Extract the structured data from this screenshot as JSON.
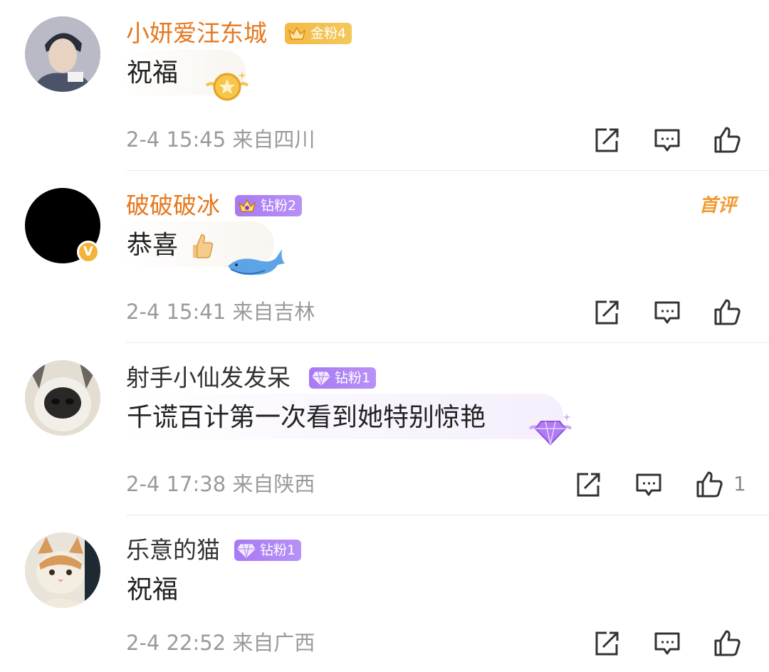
{
  "comments": [
    {
      "username": "小妍爱汪东城",
      "badge": "金粉4",
      "content": "祝福",
      "time": "2-4 15:45",
      "location": "来自四川",
      "first_tag": "",
      "likes": ""
    },
    {
      "username": "破破破冰",
      "badge": "钻粉2",
      "content": "恭喜",
      "time": "2-4 15:41",
      "location": "来自吉林",
      "first_tag": "首评",
      "likes": ""
    },
    {
      "username": "射手小仙发发呆",
      "badge": "钻粉1",
      "content": "千谎百计第一次看到她特别惊艳",
      "time": "2-4 17:38",
      "location": "来自陕西",
      "first_tag": "",
      "likes": "1"
    },
    {
      "username": "乐意的猫",
      "badge": "钻粉1",
      "content": "祝福",
      "time": "2-4 22:52",
      "location": "来自广西",
      "first_tag": "",
      "likes": ""
    }
  ],
  "icons": {
    "repost": "repost-icon",
    "comment": "comment-icon",
    "like": "thumbs-up-icon"
  },
  "colors": {
    "gold_username": "#e6781e",
    "gold_badge": "#f6b843",
    "diamond_badge": "#a77af4",
    "first_tag": "#f09a32"
  }
}
